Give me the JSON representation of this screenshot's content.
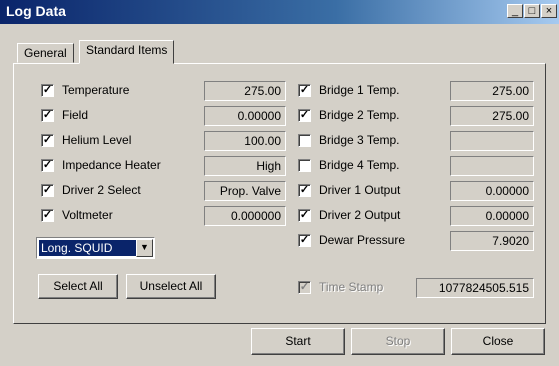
{
  "window": {
    "title": "Log Data",
    "controls": {
      "minimize": "_",
      "maximize": "□",
      "close": "×"
    }
  },
  "tabs": [
    {
      "label": "General",
      "active": false
    },
    {
      "label": "Standard Items",
      "active": true
    }
  ],
  "left_items": [
    {
      "label": "Temperature",
      "checked": true,
      "value": "275.00"
    },
    {
      "label": "Field",
      "checked": true,
      "value": "0.00000"
    },
    {
      "label": "Helium Level",
      "checked": true,
      "value": "100.00"
    },
    {
      "label": "Impedance Heater",
      "checked": true,
      "value": "High"
    },
    {
      "label": "Driver 2 Select",
      "checked": true,
      "value": "Prop. Valve"
    },
    {
      "label": "Voltmeter",
      "checked": true,
      "value": "0.000000"
    }
  ],
  "right_items": [
    {
      "label": "Bridge 1 Temp.",
      "checked": true,
      "value": "275.00"
    },
    {
      "label": "Bridge 2 Temp.",
      "checked": true,
      "value": "275.00"
    },
    {
      "label": "Bridge 3 Temp.",
      "checked": false,
      "value": ""
    },
    {
      "label": "Bridge 4 Temp.",
      "checked": false,
      "value": ""
    },
    {
      "label": "Driver 1 Output",
      "checked": true,
      "value": "0.00000"
    },
    {
      "label": "Driver 2 Output",
      "checked": true,
      "value": "0.00000"
    },
    {
      "label": "Dewar Pressure",
      "checked": true,
      "value": "7.9020"
    }
  ],
  "voltmeter_select": {
    "selected": "Long. SQUID"
  },
  "time_stamp": {
    "label": "Time Stamp",
    "checked": true,
    "disabled": true,
    "value": "1077824505.515"
  },
  "buttons": {
    "select_all": "Select All",
    "unselect_all": "Unselect All",
    "start": "Start",
    "stop": "Stop",
    "close": "Close"
  },
  "check_glyph": "✓"
}
